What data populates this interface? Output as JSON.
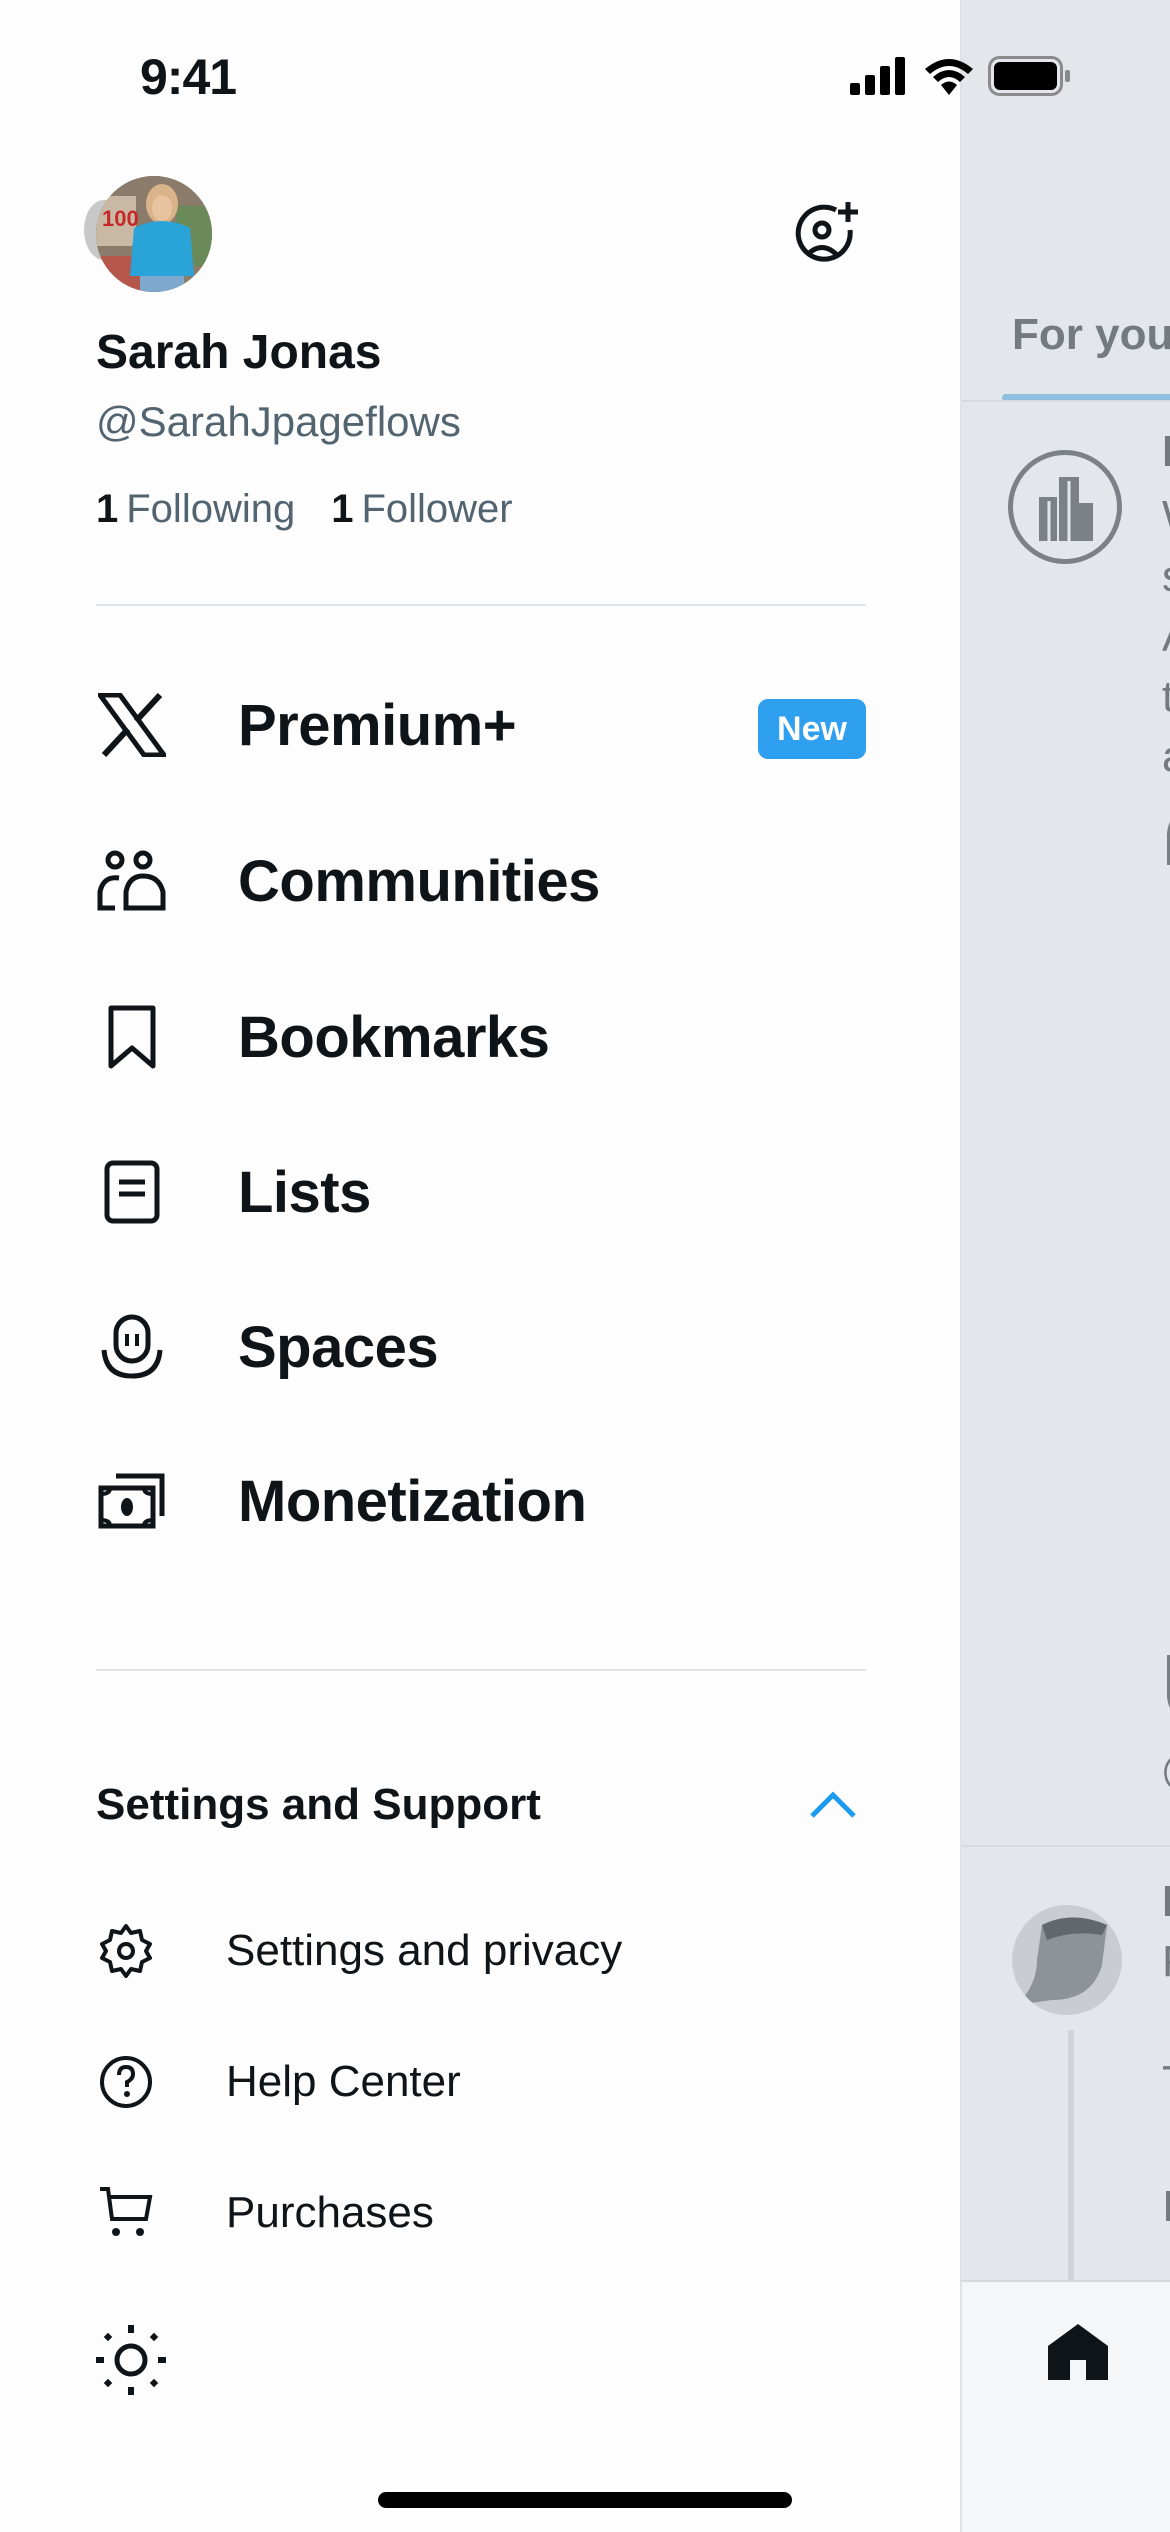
{
  "status_bar": {
    "time": "9:41"
  },
  "profile": {
    "name": "Sarah Jonas",
    "handle": "@SarahJpageflows",
    "following_count": "1",
    "following_label": "Following",
    "followers_count": "1",
    "followers_label": "Follower"
  },
  "nav": {
    "items": [
      {
        "label": "Premium+",
        "icon": "x-logo-icon",
        "badge": "New"
      },
      {
        "label": "Communities",
        "icon": "communities-icon"
      },
      {
        "label": "Bookmarks",
        "icon": "bookmark-icon"
      },
      {
        "label": "Lists",
        "icon": "lists-icon"
      },
      {
        "label": "Spaces",
        "icon": "spaces-icon"
      },
      {
        "label": "Monetization",
        "icon": "money-icon"
      }
    ]
  },
  "settings_section": {
    "title": "Settings and Support",
    "expanded": true,
    "items": [
      {
        "label": "Settings and privacy",
        "icon": "gear-icon"
      },
      {
        "label": "Help Center",
        "icon": "help-circle-icon"
      },
      {
        "label": "Purchases",
        "icon": "cart-icon"
      }
    ]
  },
  "background_feed": {
    "tab_label": "For you",
    "post1_text_fragments": [
      "N",
      "W",
      "s",
      "A",
      "t",
      "a"
    ],
    "post2_text_fragments": [
      "H",
      "F",
      "T",
      "I'"
    ]
  },
  "colors": {
    "accent": "#1d9bf0",
    "badge": "#2f9ff0",
    "text_primary": "#0f1419",
    "text_secondary": "#536471"
  }
}
